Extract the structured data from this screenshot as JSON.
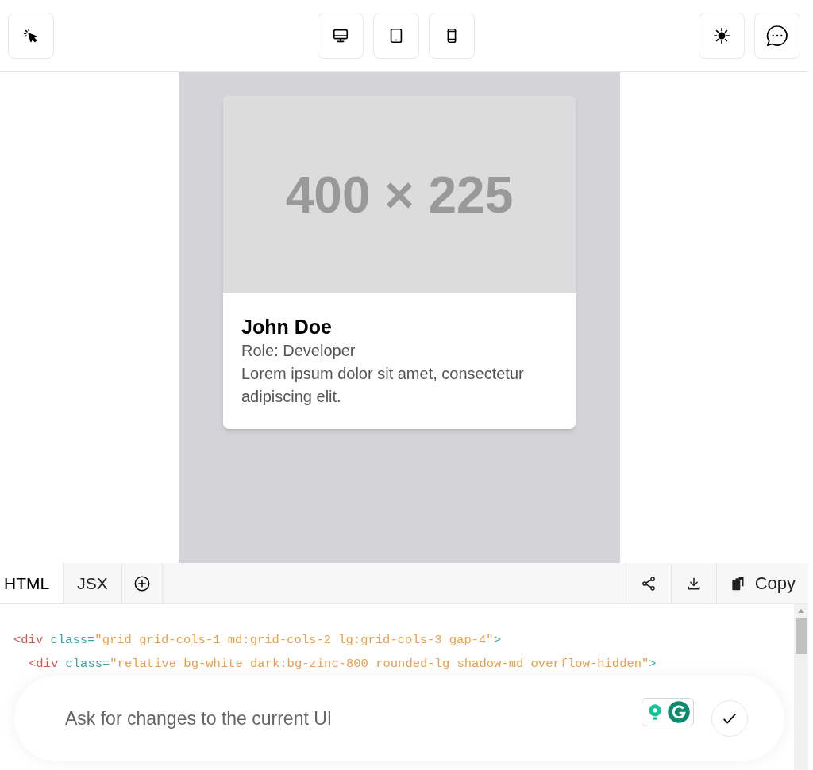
{
  "toolbar": {
    "left": [
      {
        "kind": "pointer"
      }
    ],
    "center": [
      {
        "kind": "desktop"
      },
      {
        "kind": "tablet"
      },
      {
        "kind": "phone"
      }
    ],
    "right": [
      {
        "kind": "sun"
      },
      {
        "kind": "chat"
      }
    ]
  },
  "preview": {
    "card": {
      "image_label": "400 × 225",
      "name": "John Doe",
      "role": "Role: Developer",
      "description": "Lorem ipsum dolor sit amet, consectetur adipiscing elit."
    }
  },
  "code_panel": {
    "tabs": [
      {
        "label": "HTML",
        "selected": true
      },
      {
        "label": "JSX",
        "selected": false
      }
    ],
    "actions": [
      {
        "kind": "share"
      },
      {
        "kind": "download"
      },
      {
        "kind": "copy",
        "label": "Copy"
      }
    ],
    "lines": [
      {
        "tokens": [
          {
            "kind": "tag",
            "text": "<div"
          },
          {
            "kind": "attr",
            "text": " class="
          },
          {
            "kind": "string",
            "text": "\"grid grid-cols-1 md:grid-cols-2 lg:grid-cols-3 gap-4\""
          },
          {
            "kind": "attr",
            "text": ">"
          }
        ],
        "children": [
          {
            "tokens": [
              {
                "kind": "tag",
                "text": "<div"
              },
              {
                "kind": "attr",
                "text": " class="
              },
              {
                "kind": "string",
                "text": "\"relative bg-white dark:bg-zinc-800 rounded-lg shadow-md overflow-hidden\""
              },
              {
                "kind": "attr",
                "text": ">"
              }
            ]
          }
        ]
      }
    ]
  },
  "prompt": {
    "placeholder": "Ask for changes to the current UI"
  }
}
